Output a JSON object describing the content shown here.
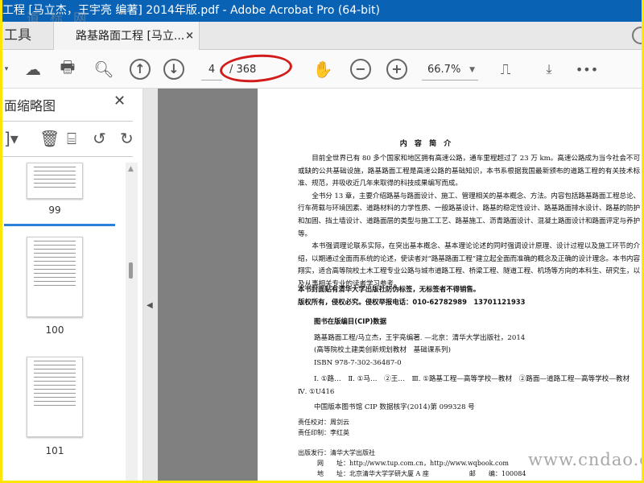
{
  "window": {
    "title": "工程 [马立杰，王宇亮 编著] 2014年版.pdf - Adobe Acrobat Pro (64-bit)",
    "watermark": "道 标 网"
  },
  "tabs": {
    "tools": "工具",
    "document": "路基路面工程 [马立...",
    "close": "×"
  },
  "toolbar": {
    "page_current": "4",
    "page_total": "/ 368",
    "zoom": "66.7%"
  },
  "sidebar": {
    "title": "面缩略图",
    "close": "✕",
    "thumbnails": [
      {
        "label": "99"
      },
      {
        "label": "100"
      },
      {
        "label": "101"
      }
    ]
  },
  "page": {
    "heading": "内 容 简 介",
    "paragraphs": [
      "目前全世界已有 80 多个国家和地区拥有高速公路，通车里程超过了 23 万 km。高速公路成为当今社会不可或缺的公共基础设施，路基路面工程是高速公路的基础知识，本书系根据我国最新颁布的道路工程的有关技术标准、规范，并吸收近几年来取得的科技成果编写而成。",
      "全书分 13 章，主要介绍路基与路面设计、施工、管理相关的基本概念、方法。内容包括路基路面工程总论、行车荷载与环境因素、道路材料的力学性质、一般路基设计、路基的稳定性设计、路基路面排水设计、路基的防护和加固、挡土墙设计、道路面层的类型与施工工艺、路基施工、沥青路面设计、混凝土路面设计和路面评定与养护等。",
      "本书强调理论联系实际，在突出基本概念、基本理论论述的同时强调设计原理、设计过程以及施工环节的介绍，以期通过全面而系统的论述，使读者对“路基路面工程”建立起全面而准确的概念及正确的设计理念。本书内容翔实，适合高等院校土木工程专业公路与城市道路工程、桥梁工程、隧道工程、机场等方向的本科生、研究生，以及从事相关专业的读者学习参考。"
    ],
    "notice1": "本书封面贴有清华大学出版社防伪标签，无标签者不得销售。",
    "notice2": "版权所有，侵权必究。侵权举报电话：010-62782989　13701121933",
    "cip_title": "图书在版编目(CIP)数据",
    "cip_lines": [
      "路基路面工程/马立杰，王宇亮编著. —北京：清华大学出版社，2014",
      "(高等院校土建类创新规划教材　基础课系列)",
      "ISBN 978-7-302-36487-0"
    ],
    "class_line": "Ⅰ. ①路…　Ⅱ. ①马…　②王…　Ⅲ. ①路基工程—高等学校—教材　②路面—道路工程—高等学校—教材　Ⅳ. ①U416",
    "cip_no": "中国版本图书馆 CIP 数据核字(2014)第 099328 号",
    "proof": "责任校对：周剑云",
    "print": "责任印制：李红英",
    "publisher": "出版发行：清华大学出版社",
    "web": "网　　址：http://www.tup.com.cn，http://www.wqbook.com",
    "address": "地　　址：北京清华大学学研大厦 A 座",
    "postcode": "邮　　编：100084",
    "watermark": "www.cndao.com"
  },
  "colors": {
    "titlebar": "#0a62b4",
    "annotation": "#d21c1c",
    "selection": "#2c80d8",
    "frame": "#ffe600"
  }
}
